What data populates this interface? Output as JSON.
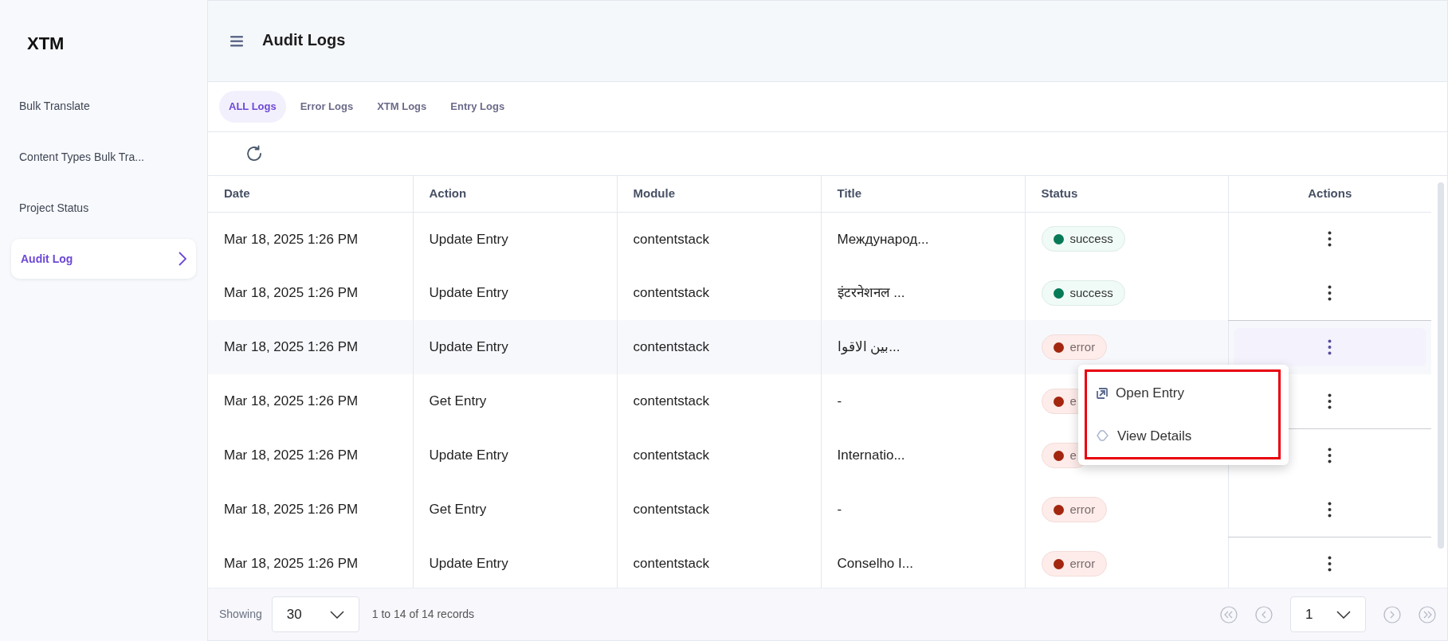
{
  "sidebar": {
    "logo": "XTM",
    "items": [
      {
        "label": "Bulk Translate",
        "selected": false
      },
      {
        "label": "Content Types Bulk Tra...",
        "selected": false
      },
      {
        "label": "Project Status",
        "selected": false
      },
      {
        "label": "Audit Log",
        "selected": true
      }
    ]
  },
  "header": {
    "title": "Audit Logs"
  },
  "tabs": [
    {
      "label": "ALL Logs",
      "selected": true
    },
    {
      "label": "Error Logs",
      "selected": false
    },
    {
      "label": "XTM Logs",
      "selected": false
    },
    {
      "label": "Entry Logs",
      "selected": false
    }
  ],
  "table": {
    "columns": [
      "Date",
      "Action",
      "Module",
      "Title",
      "Status",
      "Actions"
    ],
    "rows": [
      {
        "date": "Mar 18, 2025 1:26 PM",
        "action": "Update Entry",
        "module": "contentstack",
        "title": "Международ...",
        "status": {
          "label": "success",
          "kind": "success",
          "color": "#067a57"
        },
        "highlighted": false
      },
      {
        "date": "Mar 18, 2025 1:26 PM",
        "action": "Update Entry",
        "module": "contentstack",
        "title": "इंटरनेशनल ...",
        "status": {
          "label": "success",
          "kind": "success",
          "color": "#067a57"
        },
        "highlighted": false
      },
      {
        "date": "Mar 18, 2025 1:26 PM",
        "action": "Update Entry",
        "module": "contentstack",
        "title": "بين الاقوا...",
        "status": {
          "label": "error",
          "kind": "error",
          "color": "#a3260f"
        },
        "highlighted": true
      },
      {
        "date": "Mar 18, 2025 1:26 PM",
        "action": "Get Entry",
        "module": "contentstack",
        "title": "-",
        "status": {
          "label": "e",
          "kind": "error",
          "color": "#a3260f"
        },
        "highlighted": false
      },
      {
        "date": "Mar 18, 2025 1:26 PM",
        "action": "Update Entry",
        "module": "contentstack",
        "title": "Internatio...",
        "status": {
          "label": "e",
          "kind": "error",
          "color": "#a3260f"
        },
        "highlighted": false
      },
      {
        "date": "Mar 18, 2025 1:26 PM",
        "action": "Get Entry",
        "module": "contentstack",
        "title": "-",
        "status": {
          "label": "error",
          "kind": "error",
          "color": "#a3260f"
        },
        "highlighted": false
      },
      {
        "date": "Mar 18, 2025 1:26 PM",
        "action": "Update Entry",
        "module": "contentstack",
        "title": "Conselho I...",
        "status": {
          "label": "error",
          "kind": "error",
          "color": "#a3260f"
        },
        "highlighted": false
      }
    ]
  },
  "row_menu": {
    "items": [
      {
        "label": "Open Entry",
        "kind": "open"
      },
      {
        "label": "View Details",
        "kind": "details"
      }
    ]
  },
  "footer": {
    "showing_label": "Showing",
    "page_size": "30",
    "records": "1 to 14 of 14 records",
    "page": "1"
  }
}
